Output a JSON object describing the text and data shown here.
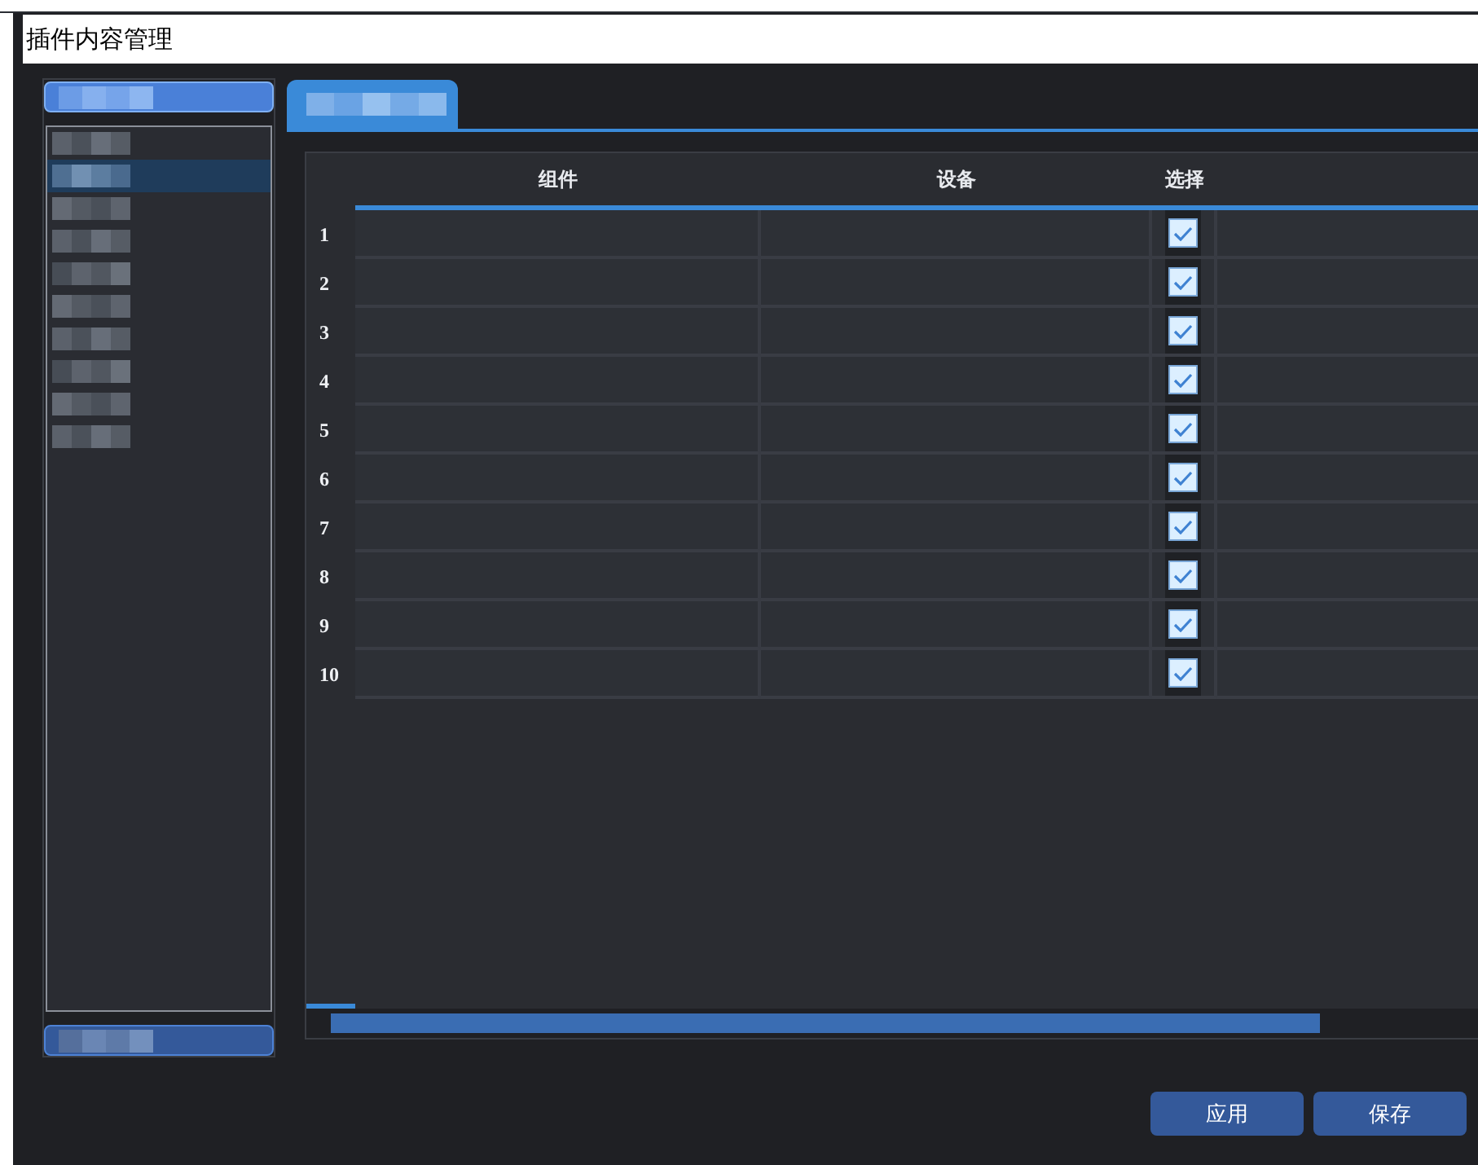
{
  "window": {
    "title": "插件内容管理"
  },
  "list": {
    "items": [
      {
        "selected": false
      },
      {
        "selected": true
      },
      {
        "selected": false
      },
      {
        "selected": false
      },
      {
        "selected": false
      },
      {
        "selected": false
      },
      {
        "selected": false
      },
      {
        "selected": false
      },
      {
        "selected": false
      },
      {
        "selected": false
      }
    ]
  },
  "tabs": [
    {
      "selected": true
    }
  ],
  "table": {
    "columns": [
      "组件",
      "设备",
      "选择"
    ],
    "rows": [
      {
        "number": "1",
        "checked": true
      },
      {
        "number": "2",
        "checked": true
      },
      {
        "number": "3",
        "checked": true
      },
      {
        "number": "4",
        "checked": true
      },
      {
        "number": "5",
        "checked": true
      },
      {
        "number": "6",
        "checked": true
      },
      {
        "number": "7",
        "checked": true
      },
      {
        "number": "8",
        "checked": true
      },
      {
        "number": "9",
        "checked": true
      },
      {
        "number": "10",
        "checked": true
      }
    ]
  },
  "buttons": [
    "应用",
    "保存"
  ]
}
